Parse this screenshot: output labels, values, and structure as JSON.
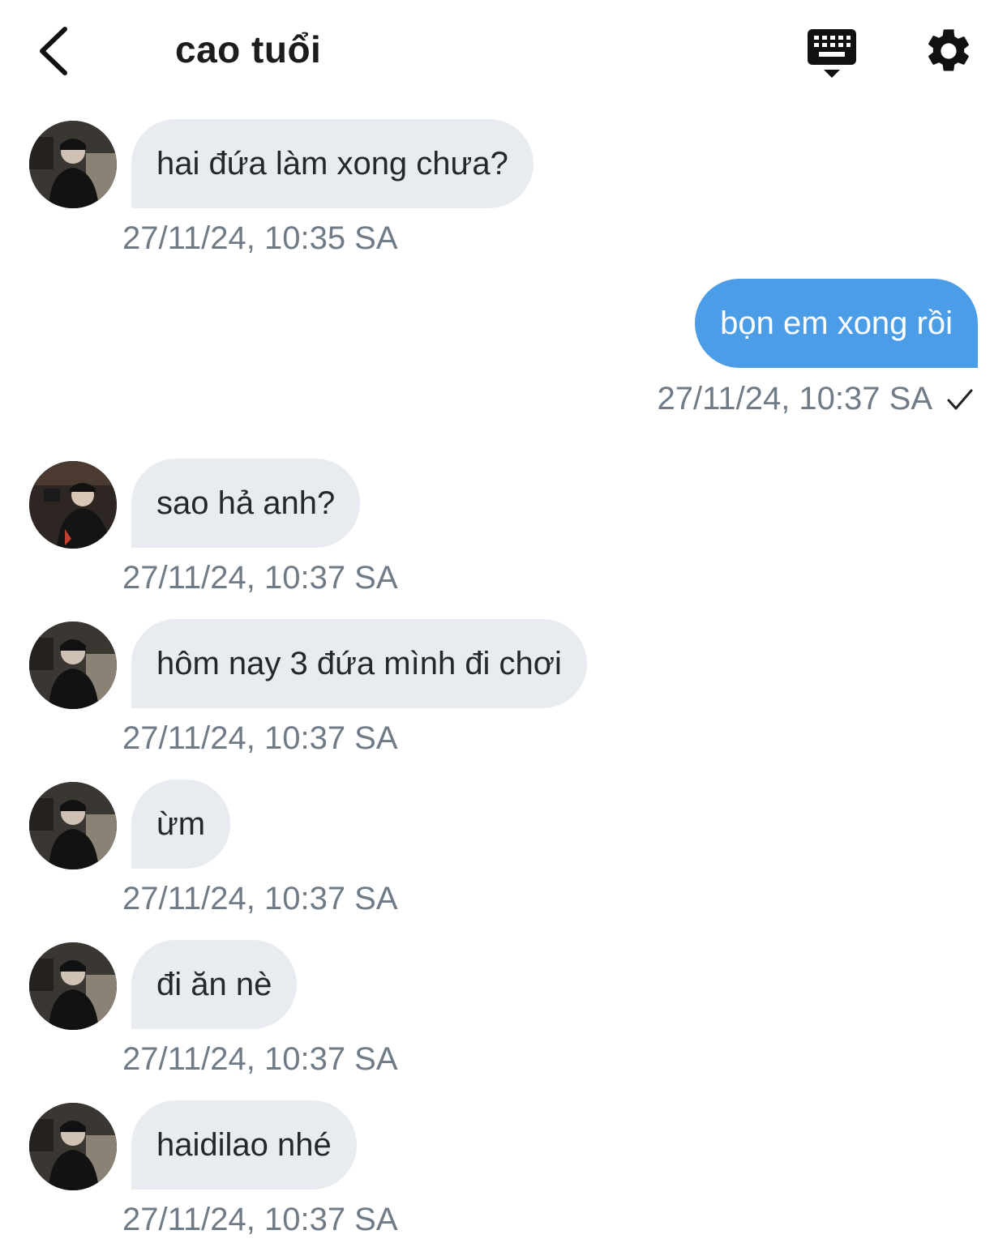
{
  "header": {
    "title": "cao tuổi",
    "back_icon": "chevron-left-icon",
    "keyboard_icon": "keyboard-icon",
    "settings_icon": "gear-icon"
  },
  "colors": {
    "incoming_bubble": "#e8ebef",
    "outgoing_bubble": "#4c9de8",
    "timestamp": "#6f7b86"
  },
  "messages": [
    {
      "direction": "incoming",
      "text": "hai đứa làm xong chưa?",
      "time": "27/11/24, 10:35 SA"
    },
    {
      "direction": "outgoing",
      "text": "bọn em xong rồi",
      "time": "27/11/24, 10:37 SA",
      "status_icon": "checkmark-icon"
    },
    {
      "direction": "incoming",
      "text": "sao hả anh?",
      "time": "27/11/24, 10:37 SA"
    },
    {
      "direction": "incoming",
      "text": "hôm nay 3 đứa mình đi chơi",
      "time": "27/11/24, 10:37 SA"
    },
    {
      "direction": "incoming",
      "text": "ừm",
      "time": "27/11/24, 10:37 SA"
    },
    {
      "direction": "incoming",
      "text": "đi ăn nè",
      "time": "27/11/24, 10:37 SA"
    },
    {
      "direction": "incoming",
      "text": "haidilao nhé",
      "time": "27/11/24, 10:37 SA"
    }
  ]
}
